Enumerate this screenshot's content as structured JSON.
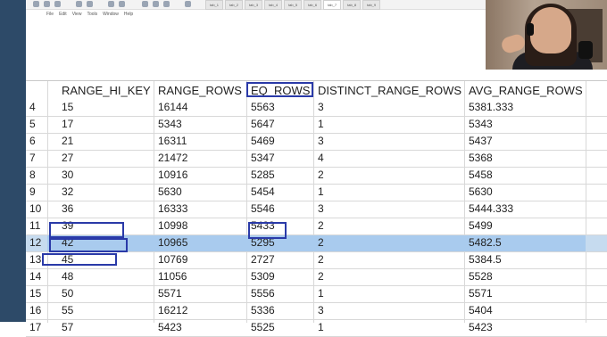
{
  "app": {
    "menu": [
      "File",
      "Edit",
      "View",
      "Tools",
      "Window",
      "Help"
    ],
    "tabs": [
      "tab_1",
      "tab_2",
      "tab_3",
      "tab_4",
      "tab_5",
      "tab_6",
      "tab_7",
      "tab_8",
      "tab_9"
    ]
  },
  "webcam": {
    "label": "presenter-video"
  },
  "grid": {
    "columns": [
      "RANGE_HI_KEY",
      "RANGE_ROWS",
      "EQ_ROWS",
      "DISTINCT_RANGE_ROWS",
      "AVG_RANGE_ROWS"
    ],
    "highlight_column": "EQ_ROWS",
    "selected_row": "12",
    "rows": [
      {
        "n": "4",
        "range_hi_key": "15",
        "range_rows": "16144",
        "eq_rows": "5563",
        "distinct": "3",
        "avg": "5381.333"
      },
      {
        "n": "5",
        "range_hi_key": "17",
        "range_rows": "5343",
        "eq_rows": "5647",
        "distinct": "1",
        "avg": "5343"
      },
      {
        "n": "6",
        "range_hi_key": "21",
        "range_rows": "16311",
        "eq_rows": "5469",
        "distinct": "3",
        "avg": "5437"
      },
      {
        "n": "7",
        "range_hi_key": "27",
        "range_rows": "21472",
        "eq_rows": "5347",
        "distinct": "4",
        "avg": "5368"
      },
      {
        "n": "8",
        "range_hi_key": "30",
        "range_rows": "10916",
        "eq_rows": "5285",
        "distinct": "2",
        "avg": "5458"
      },
      {
        "n": "9",
        "range_hi_key": "32",
        "range_rows": "5630",
        "eq_rows": "5454",
        "distinct": "1",
        "avg": "5630"
      },
      {
        "n": "10",
        "range_hi_key": "36",
        "range_rows": "16333",
        "eq_rows": "5546",
        "distinct": "3",
        "avg": "5444.333"
      },
      {
        "n": "11",
        "range_hi_key": "39",
        "range_rows": "10998",
        "eq_rows": "5433",
        "distinct": "2",
        "avg": "5499"
      },
      {
        "n": "12",
        "range_hi_key": "42",
        "range_rows": "10965",
        "eq_rows": "5295",
        "distinct": "2",
        "avg": "5482.5"
      },
      {
        "n": "13",
        "range_hi_key": "45",
        "range_rows": "10769",
        "eq_rows": "2727",
        "distinct": "2",
        "avg": "5384.5"
      },
      {
        "n": "14",
        "range_hi_key": "48",
        "range_rows": "11056",
        "eq_rows": "5309",
        "distinct": "2",
        "avg": "5528"
      },
      {
        "n": "15",
        "range_hi_key": "50",
        "range_rows": "5571",
        "eq_rows": "5556",
        "distinct": "1",
        "avg": "5571"
      },
      {
        "n": "16",
        "range_hi_key": "55",
        "range_rows": "16212",
        "eq_rows": "5336",
        "distinct": "3",
        "avg": "5404"
      },
      {
        "n": "17",
        "range_hi_key": "57",
        "range_rows": "5423",
        "eq_rows": "5525",
        "distinct": "1",
        "avg": "5423"
      }
    ]
  },
  "colors": {
    "selection": "#a9cbee",
    "annotation": "#2a3aa8",
    "sidebar": "#2d4a68"
  }
}
